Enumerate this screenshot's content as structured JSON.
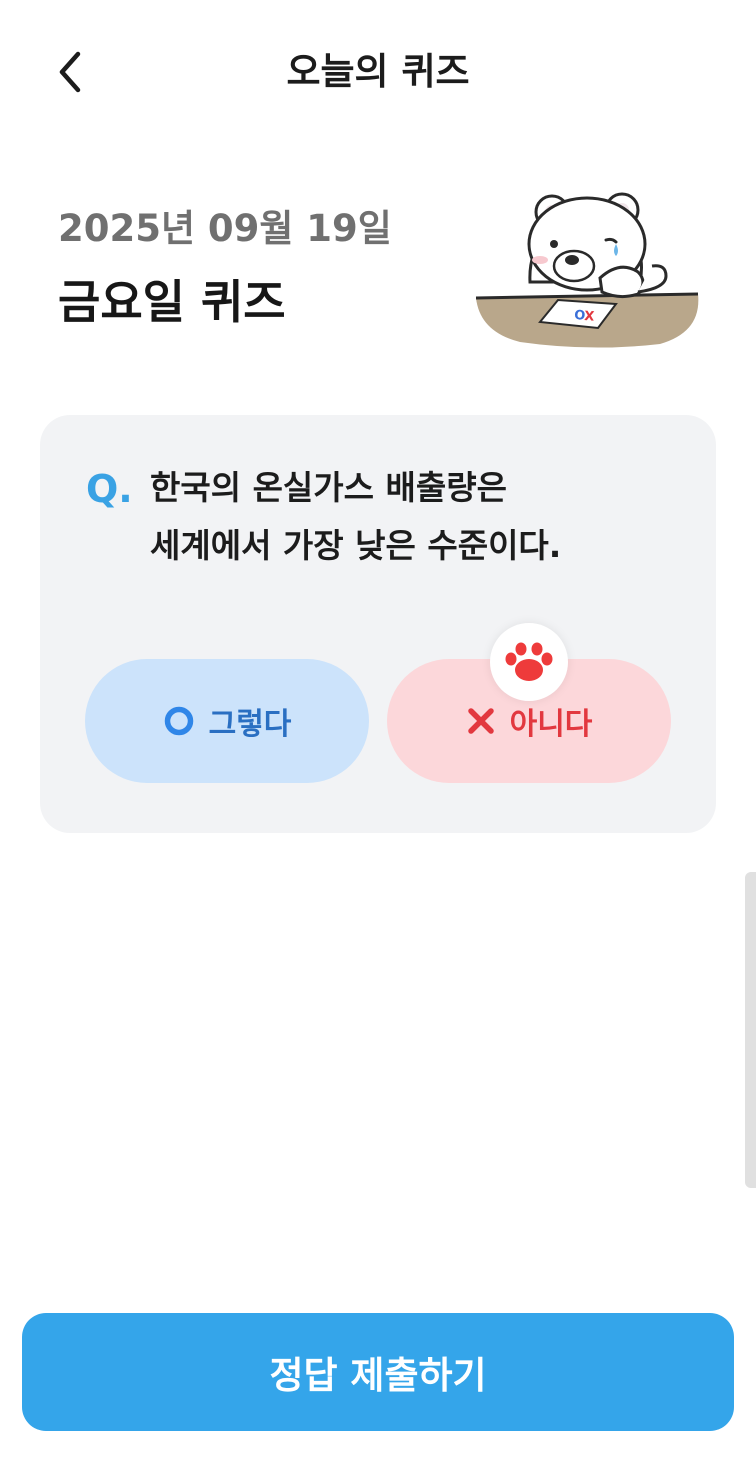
{
  "header": {
    "title": "오늘의 퀴즈"
  },
  "quiz": {
    "date": "2025년 09월 19일",
    "name": "금요일 퀴즈",
    "question_prefix": "Q.",
    "question_lines": [
      "한국의 온실가스 배출량은",
      "세계에서 가장 낮은 수준이다."
    ],
    "options": {
      "yes": {
        "label": "그렇다",
        "icon": "circle-o-icon"
      },
      "no": {
        "label": "아니다",
        "icon": "x-mark-icon",
        "selected": true
      }
    },
    "selection_marker_icon": "paw-print-icon"
  },
  "mascot": {
    "icon": "polar-bear-mascot",
    "paper_text": "OX"
  },
  "submit": {
    "label": "정답 제출하기"
  },
  "colors": {
    "accent": "#34a5ea",
    "q_mark": "#3aa2e4",
    "yes_bg": "#cce3fb",
    "yes_fg": "#2a6fc2",
    "no_bg": "#fcd7da",
    "no_fg": "#e2383f",
    "card_bg": "#f2f3f5"
  }
}
